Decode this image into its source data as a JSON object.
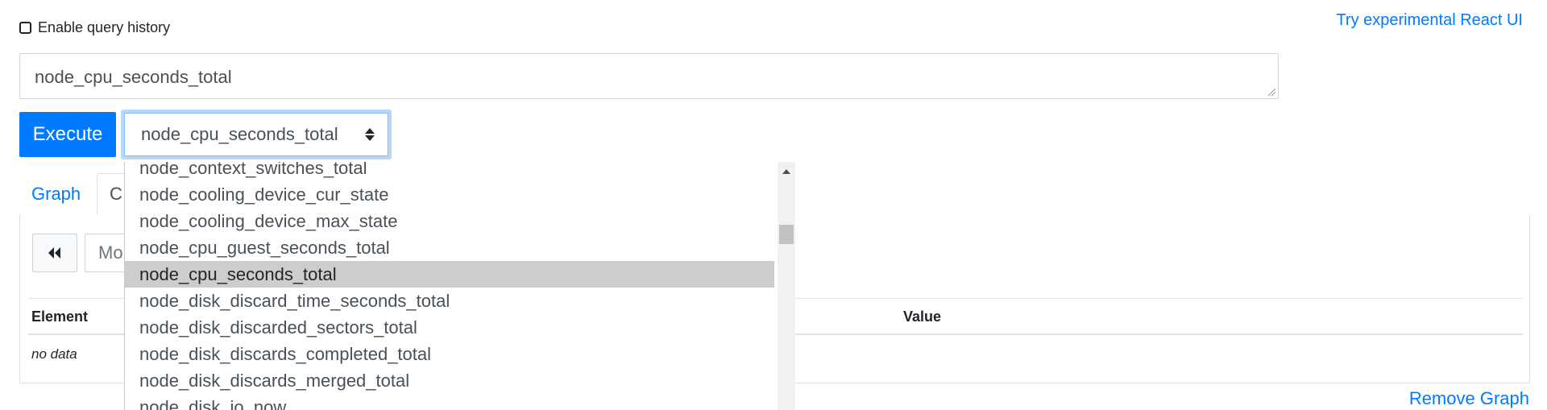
{
  "history": {
    "label": "Enable query history",
    "checked": false
  },
  "header": {
    "react_link": "Try experimental React UI"
  },
  "expression": {
    "value": "node_cpu_seconds_total"
  },
  "toolbar": {
    "execute_label": "Execute",
    "metric_select_value": "node_cpu_seconds_total"
  },
  "tabs": [
    {
      "label": "Graph",
      "active": false
    },
    {
      "label": "C",
      "active": true
    }
  ],
  "console": {
    "moment_placeholder": "Mo",
    "table": {
      "columns": [
        "Element",
        "Value"
      ],
      "empty_text": "no data"
    }
  },
  "remove_graph_label": "Remove Graph",
  "dropdown": {
    "options": [
      "node_context_switches_total",
      "node_cooling_device_cur_state",
      "node_cooling_device_max_state",
      "node_cpu_guest_seconds_total",
      "node_cpu_seconds_total",
      "node_disk_discard_time_seconds_total",
      "node_disk_discarded_sectors_total",
      "node_disk_discards_completed_total",
      "node_disk_discards_merged_total",
      "node_disk_io_now"
    ],
    "selected_index": 4
  },
  "colors": {
    "accent": "#007bff",
    "selected_option_bg": "#cdcdcd",
    "focus_ring": "#b8d7fb"
  }
}
